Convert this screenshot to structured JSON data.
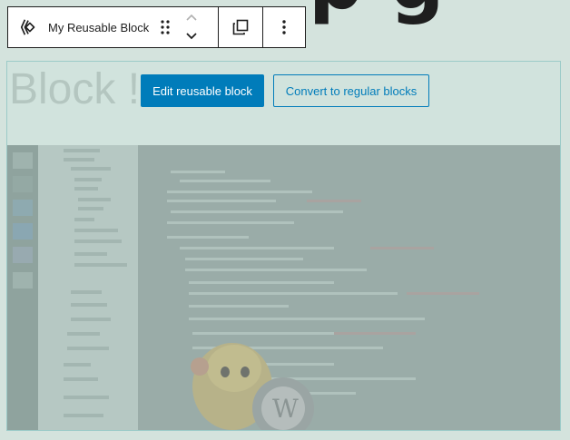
{
  "page": {
    "heading_top_fragment": "p g",
    "block_heading_text": "Block !"
  },
  "toolbar": {
    "block_title": "My Reusable Block",
    "block_icon": "reusable-block-icon",
    "drag_icon": "drag-handle-icon",
    "move_up_icon": "chevron-up-icon",
    "move_down_icon": "chevron-down-icon",
    "duplicate_icon": "duplicate-icon",
    "options_icon": "more-vertical-icon"
  },
  "reusable_block": {
    "edit_button_label": "Edit reusable block",
    "convert_button_label": "Convert to regular blocks"
  },
  "colors": {
    "background": "#d4e3dd",
    "primary": "#007cba",
    "text_dark": "#1e1e1e",
    "block_border": "#9ccbc8"
  }
}
